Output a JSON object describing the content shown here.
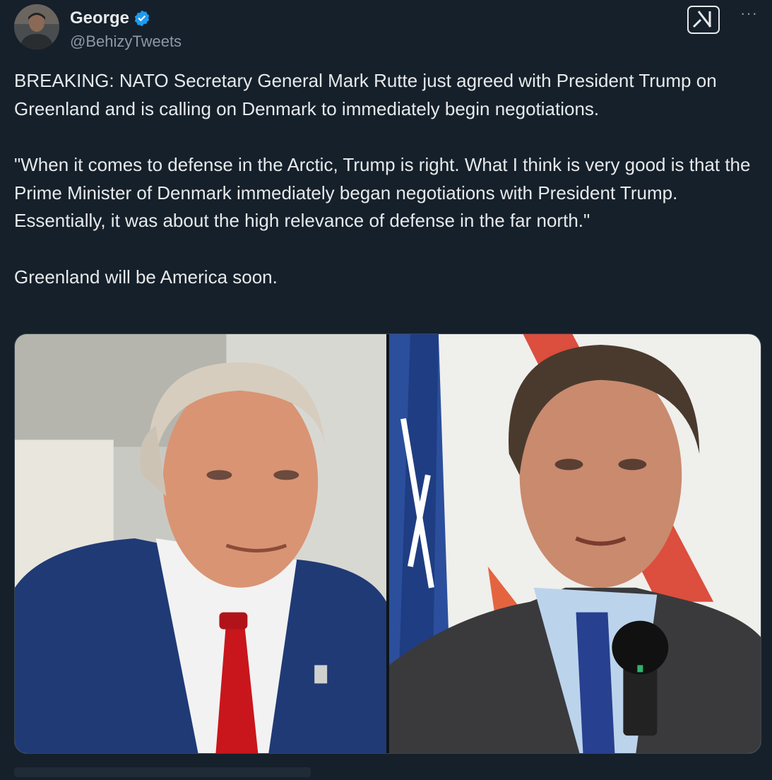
{
  "tweet": {
    "author": {
      "display_name": "George",
      "handle": "@BehizyTweets",
      "verified": true,
      "avatar_icon": "user-avatar"
    },
    "grok_icon": "grok-icon",
    "more_icon": "more-options-icon",
    "more_label": "···",
    "paragraphs": [
      "BREAKING: NATO Secretary General Mark Rutte just agreed with President Trump on Greenland and is calling on Denmark to immediately begin negotiations.",
      "\"When it comes to defense in the Arctic, Trump is right. What I think is very good is that the Prime Minister of Denmark immediately began negotiations with President Trump. Essentially, it was about the high relevance of defense in the far north.\"",
      "Greenland will be America soon."
    ],
    "media": [
      {
        "name": "photo-trump"
      },
      {
        "name": "photo-rutte"
      }
    ]
  },
  "colors": {
    "background": "#15202b",
    "text": "#e7e9ea",
    "secondary_text": "#8b98a5",
    "verified_blue": "#1d9bf0"
  }
}
